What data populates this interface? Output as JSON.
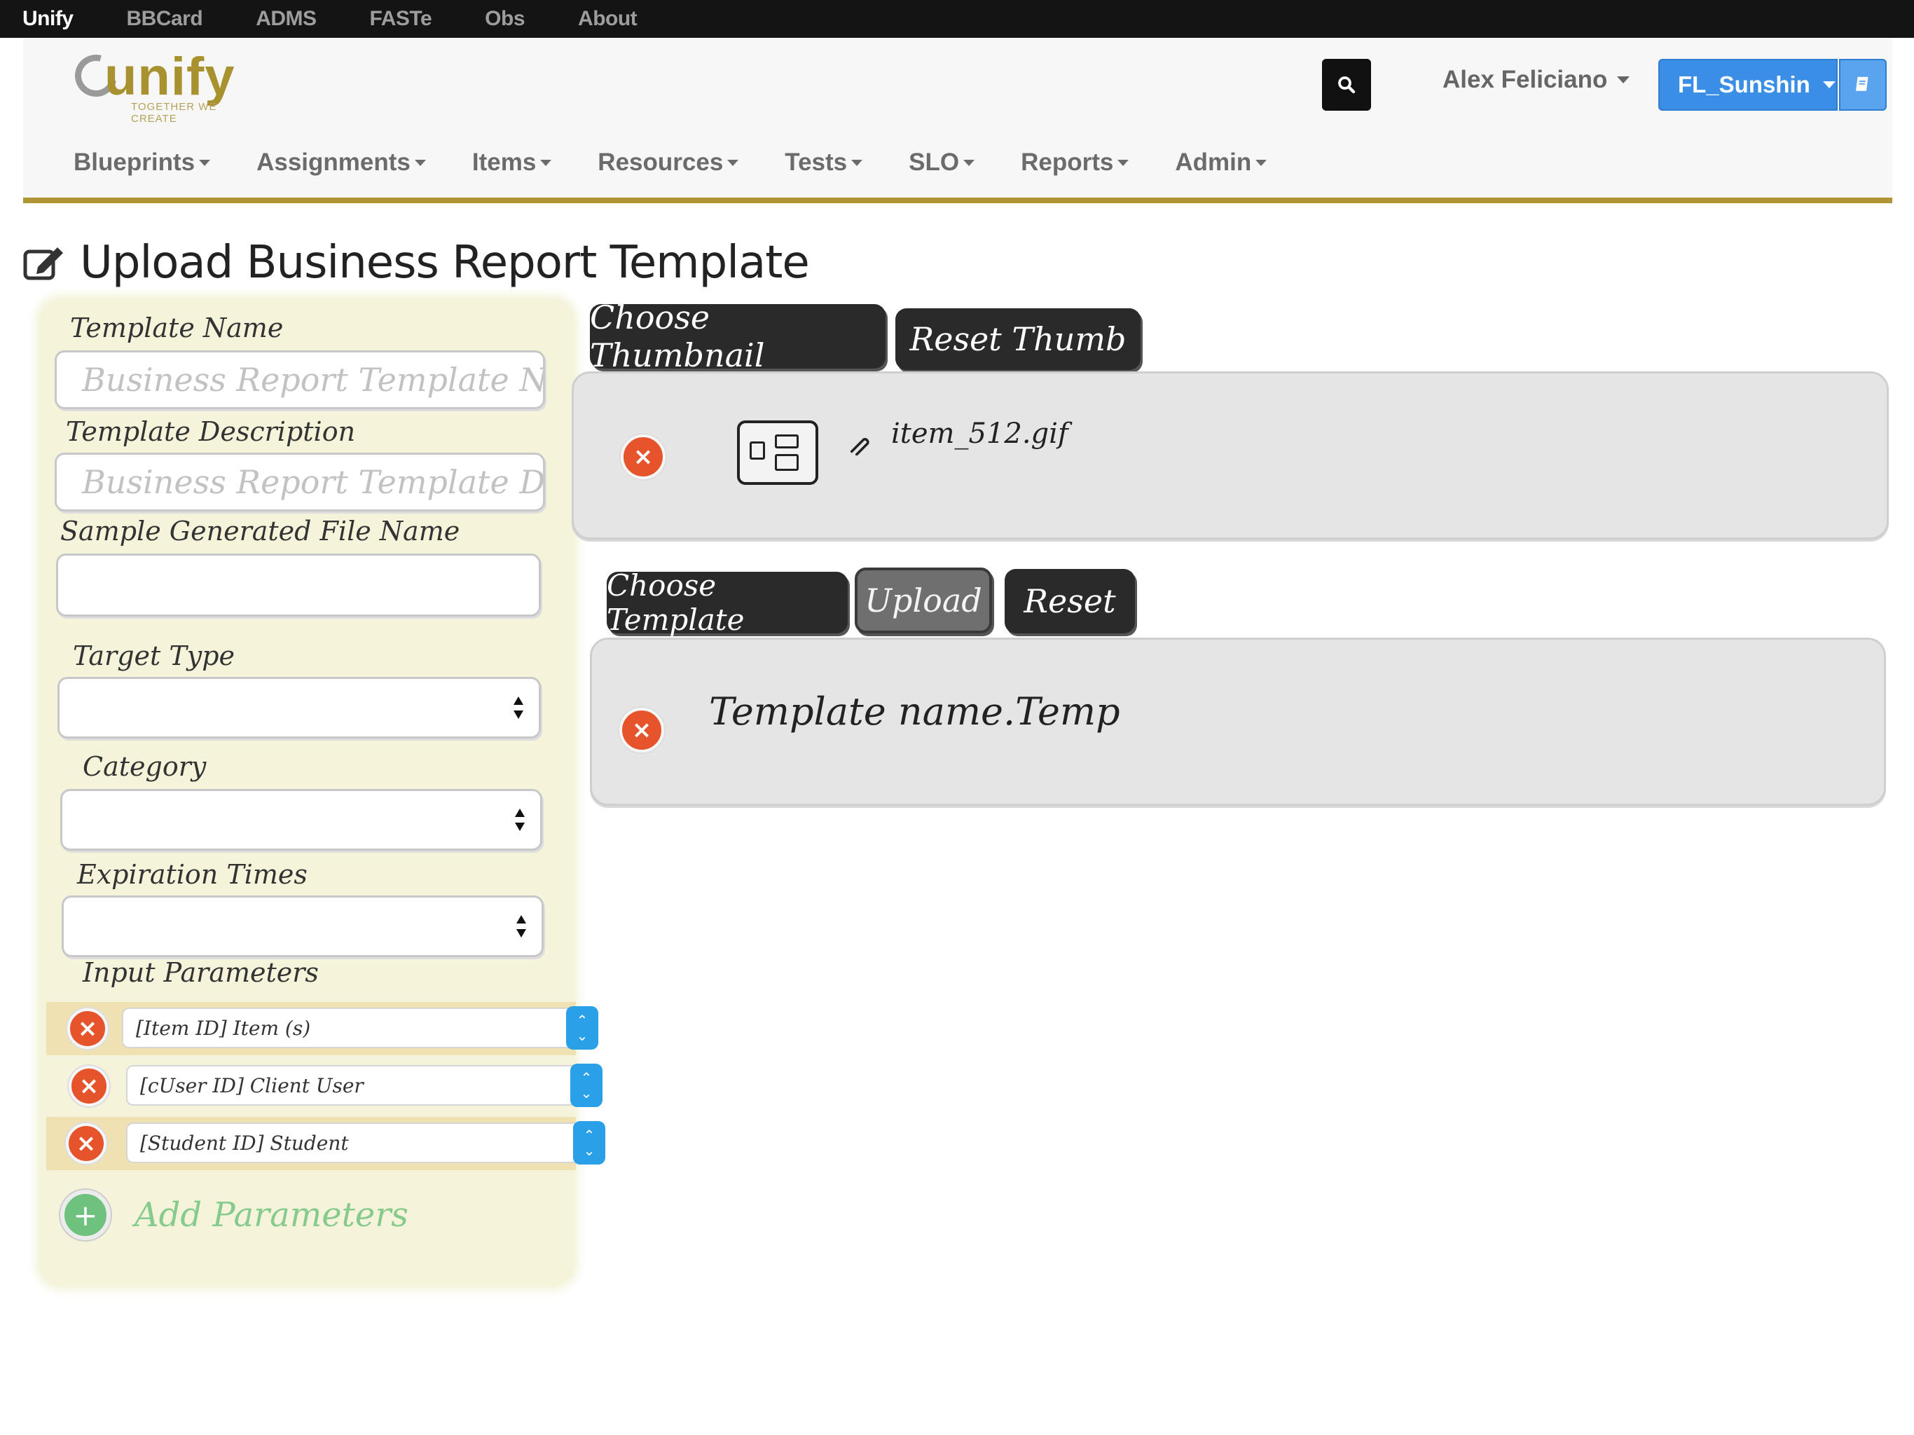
{
  "topbar": {
    "items": [
      "Unify",
      "BBCard",
      "ADMS",
      "FASTe",
      "Obs",
      "About"
    ]
  },
  "header": {
    "logo_text": "unify",
    "logo_tagline": "TOGETHER WE CREATE",
    "user_name": "Alex Feliciano",
    "district": "FL_Sunshin",
    "icons": {
      "search": "search-icon",
      "book": "book-icon"
    },
    "colors": {
      "accent": "#b09534",
      "district_button": "#3a8ee6"
    }
  },
  "nav": {
    "items": [
      "Blueprints",
      "Assignments",
      "Items",
      "Resources",
      "Tests",
      "SLO",
      "Reports",
      "Admin"
    ]
  },
  "page": {
    "title": "Upload Business Report Template"
  },
  "form": {
    "template_name_label": "Template Name",
    "template_name_placeholder": "Business Report Template Name",
    "template_description_label": "Template Description",
    "template_description_placeholder": "Business Report Template Descrip",
    "sample_file_label": "Sample Generated File Name",
    "target_type_label": "Target Type",
    "category_label": "Category",
    "expiration_label": "Expiration Times",
    "input_parameters_label": "Input Parameters",
    "parameters": [
      {
        "value": "[Item ID] Item (s)"
      },
      {
        "value": "[cUser ID] Client User"
      },
      {
        "value": "[Student ID] Student"
      }
    ],
    "add_parameters_label": "Add Parameters"
  },
  "thumbnail": {
    "choose_label": "Choose Thumbnail",
    "reset_label": "Reset Thumb",
    "file_name": "item_512.gif"
  },
  "template": {
    "choose_label": "Choose Template",
    "upload_label": "Upload",
    "reset_label": "Reset",
    "file_name": "Template name.Temp"
  }
}
